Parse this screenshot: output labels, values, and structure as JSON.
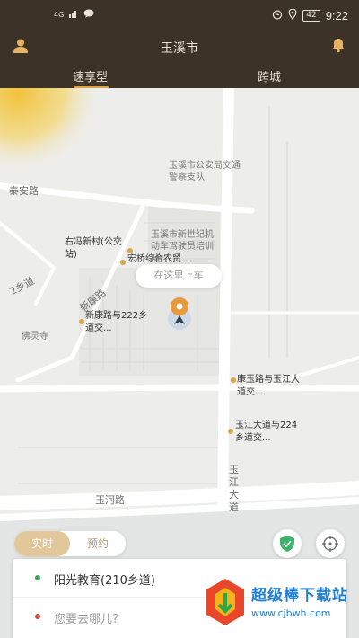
{
  "status_bar": {
    "signal": "4G",
    "battery": "42",
    "time": "9:22"
  },
  "header": {
    "city": "玉溪市",
    "tabs": [
      {
        "label": "速享型",
        "active": true
      },
      {
        "label": "跨城",
        "active": false
      }
    ]
  },
  "map": {
    "labels": {
      "police_dept": "玉溪市公安局交通警察支队",
      "taian_road": "泰安路",
      "youfeng_village": "右冯新村(公交站)",
      "hongqiao": "宏桥综合农贸...",
      "new_century_school": "玉溪市新世纪机动车驾驶员培训站",
      "xinkang_222": "新康路与222乡道交...",
      "xinkang_road": "新康路",
      "road_2": "2乡道",
      "foling_temple": "佛灵寺",
      "kangyu_yujiang": "康玉路与玉江大道交...",
      "yujiang_224": "玉江大道与224乡道交...",
      "yujiang_ave": "玉江大道",
      "yuhe_road": "玉河路"
    },
    "pickup_bubble": "在这里上车"
  },
  "mode": {
    "now": "实时",
    "book": "预约"
  },
  "route": {
    "from": "阳光教育(210乡道)",
    "to_placeholder": "您要去哪儿?"
  },
  "watermark": {
    "title": "超级棒下载站",
    "url": "www.cjbwh.com"
  },
  "colors": {
    "header_bg": "#3c3228",
    "accent": "#d9a44d",
    "map_bg": "#ededeb"
  }
}
